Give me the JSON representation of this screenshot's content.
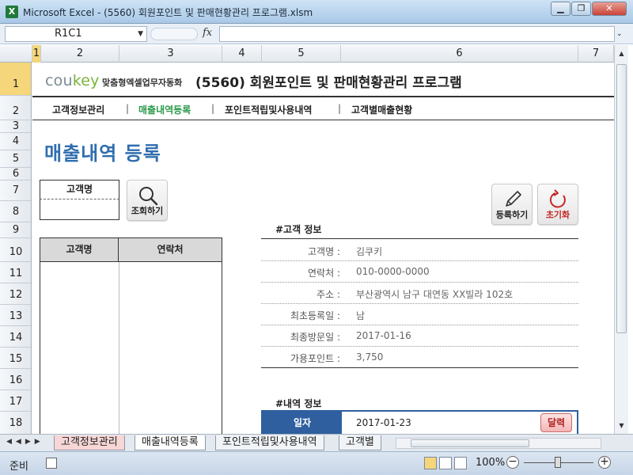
{
  "window": {
    "title": "Microsoft Excel - (5560) 회원포인트 및 판매현황관리 프로그램.xlsm",
    "app_icon": "X"
  },
  "formula_bar": {
    "name_box": "R1C1",
    "fx_label": "fx",
    "formula": ""
  },
  "columns": [
    "1",
    "2",
    "3",
    "4",
    "5",
    "6",
    "7"
  ],
  "rows": [
    "1",
    "2",
    "3",
    "4",
    "5",
    "6",
    "7",
    "8",
    "9",
    "10",
    "11",
    "12",
    "13",
    "14",
    "15",
    "16",
    "17",
    "18"
  ],
  "header": {
    "logo_main": "cou",
    "logo_accent": "key",
    "logo_sub": "맞춤형엑셀업무자동화",
    "program_title": "(5560) 회원포인트 및 판매현황관리 프로그램"
  },
  "nav": {
    "items": [
      {
        "label": "고객정보관리",
        "active": false
      },
      {
        "label": "매출내역등록",
        "active": true
      },
      {
        "label": "포인트적립및사용내역",
        "active": false
      },
      {
        "label": "고객별매출현황",
        "active": false
      }
    ],
    "separator": "|"
  },
  "page": {
    "heading": "매출내역 등록"
  },
  "search": {
    "label": "고객명",
    "value": "",
    "button_label": "조회하기"
  },
  "actions": {
    "register_label": "등록하기",
    "reset_label": "초기화"
  },
  "customer_list": {
    "headers": [
      "고객명",
      "연락처"
    ],
    "rows": []
  },
  "customer_info": {
    "section_title": "#고객 정보",
    "fields": [
      {
        "label": "고객명 :",
        "value": "김쿠키"
      },
      {
        "label": "연락처 :",
        "value": "010-0000-0000"
      },
      {
        "label": "주소 :",
        "value": "부산광역시 남구 대연동 XX빌라 102호"
      },
      {
        "label": "최초등록일 :",
        "value": "남"
      },
      {
        "label": "최종방문일 :",
        "value": "2017-01-16"
      },
      {
        "label": "가용포인트 :",
        "value": "3,750"
      }
    ]
  },
  "detail_info": {
    "section_title": "#내역 정보",
    "date_label": "일자",
    "date_value": "2017-01-23",
    "calendar_button": "달력"
  },
  "sheet_tabs": [
    {
      "label": "고객정보관리",
      "active": false,
      "colored": true
    },
    {
      "label": "매출내역등록",
      "active": true,
      "colored": false
    },
    {
      "label": "포인트적립및사용내역",
      "active": false,
      "colored": false
    },
    {
      "label": "고객별",
      "active": false,
      "colored": false
    }
  ],
  "status": {
    "ready": "준비",
    "zoom": "100%"
  },
  "colors": {
    "heading_blue": "#2f6eae",
    "active_nav_green": "#2c9a4a",
    "detail_header_blue": "#2f5f9e",
    "selected_header": "#f5d67a"
  }
}
